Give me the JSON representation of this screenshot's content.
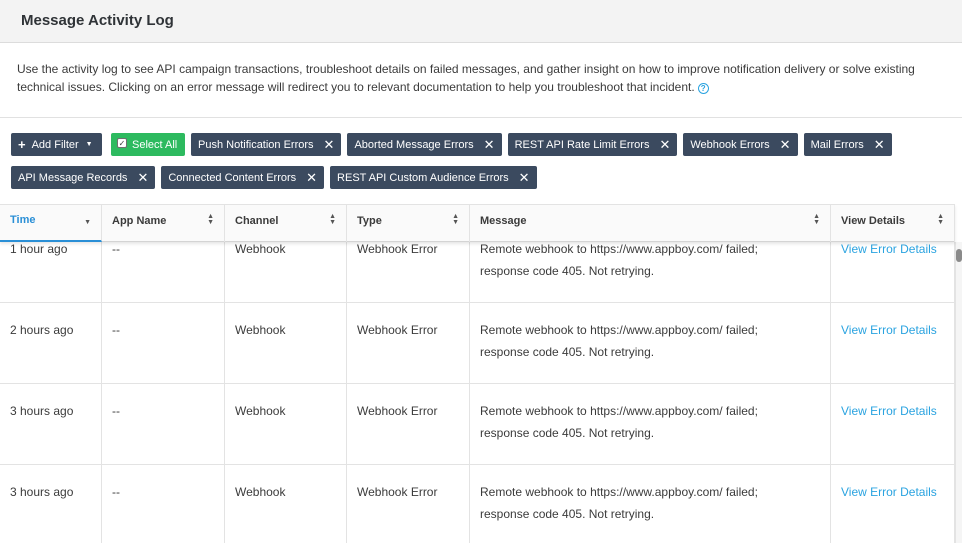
{
  "header": {
    "title": "Message Activity Log"
  },
  "description": {
    "text": "Use the activity log to see API campaign transactions, troubleshoot details on failed messages, and gather insight on how to improve notification delivery or solve existing technical issues. Clicking on an error message will redirect you to relevant documentation to help you troubleshoot that incident.",
    "help_icon": "?"
  },
  "filters": {
    "add_label": "Add Filter",
    "select_all_label": "Select All",
    "tags_row1": [
      "Push Notification Errors",
      "Aborted Message Errors",
      "REST API Rate Limit Errors",
      "Webhook Errors",
      "Mail Errors"
    ],
    "tags_row2": [
      "API Message Records",
      "Connected Content Errors",
      "REST API Custom Audience Errors"
    ]
  },
  "table": {
    "columns": [
      "Time",
      "App Name",
      "Channel",
      "Type",
      "Message",
      "View Details"
    ],
    "active_sort_column": "Time",
    "rows": [
      {
        "time": "1 hour ago",
        "app": "--",
        "channel": "Webhook",
        "type": "Webhook Error",
        "message": "Remote webhook to https://www.appboy.com/ failed; response code 405. Not retrying.",
        "details": "View Error Details"
      },
      {
        "time": "2 hours ago",
        "app": "--",
        "channel": "Webhook",
        "type": "Webhook Error",
        "message": "Remote webhook to https://www.appboy.com/ failed; response code 405. Not retrying.",
        "details": "View Error Details"
      },
      {
        "time": "3 hours ago",
        "app": "--",
        "channel": "Webhook",
        "type": "Webhook Error",
        "message": "Remote webhook to https://www.appboy.com/ failed; response code 405. Not retrying.",
        "details": "View Error Details"
      },
      {
        "time": "3 hours ago",
        "app": "--",
        "channel": "Webhook",
        "type": "Webhook Error",
        "message": "Remote webhook to https://www.appboy.com/ failed; response code 405. Not retrying.",
        "details": "View Error Details"
      }
    ]
  },
  "colors": {
    "tag_bg": "#3b4a5f",
    "select_all_bg": "#2dba5f",
    "link": "#2aa3e0",
    "active_sort": "#2a8fd6"
  }
}
